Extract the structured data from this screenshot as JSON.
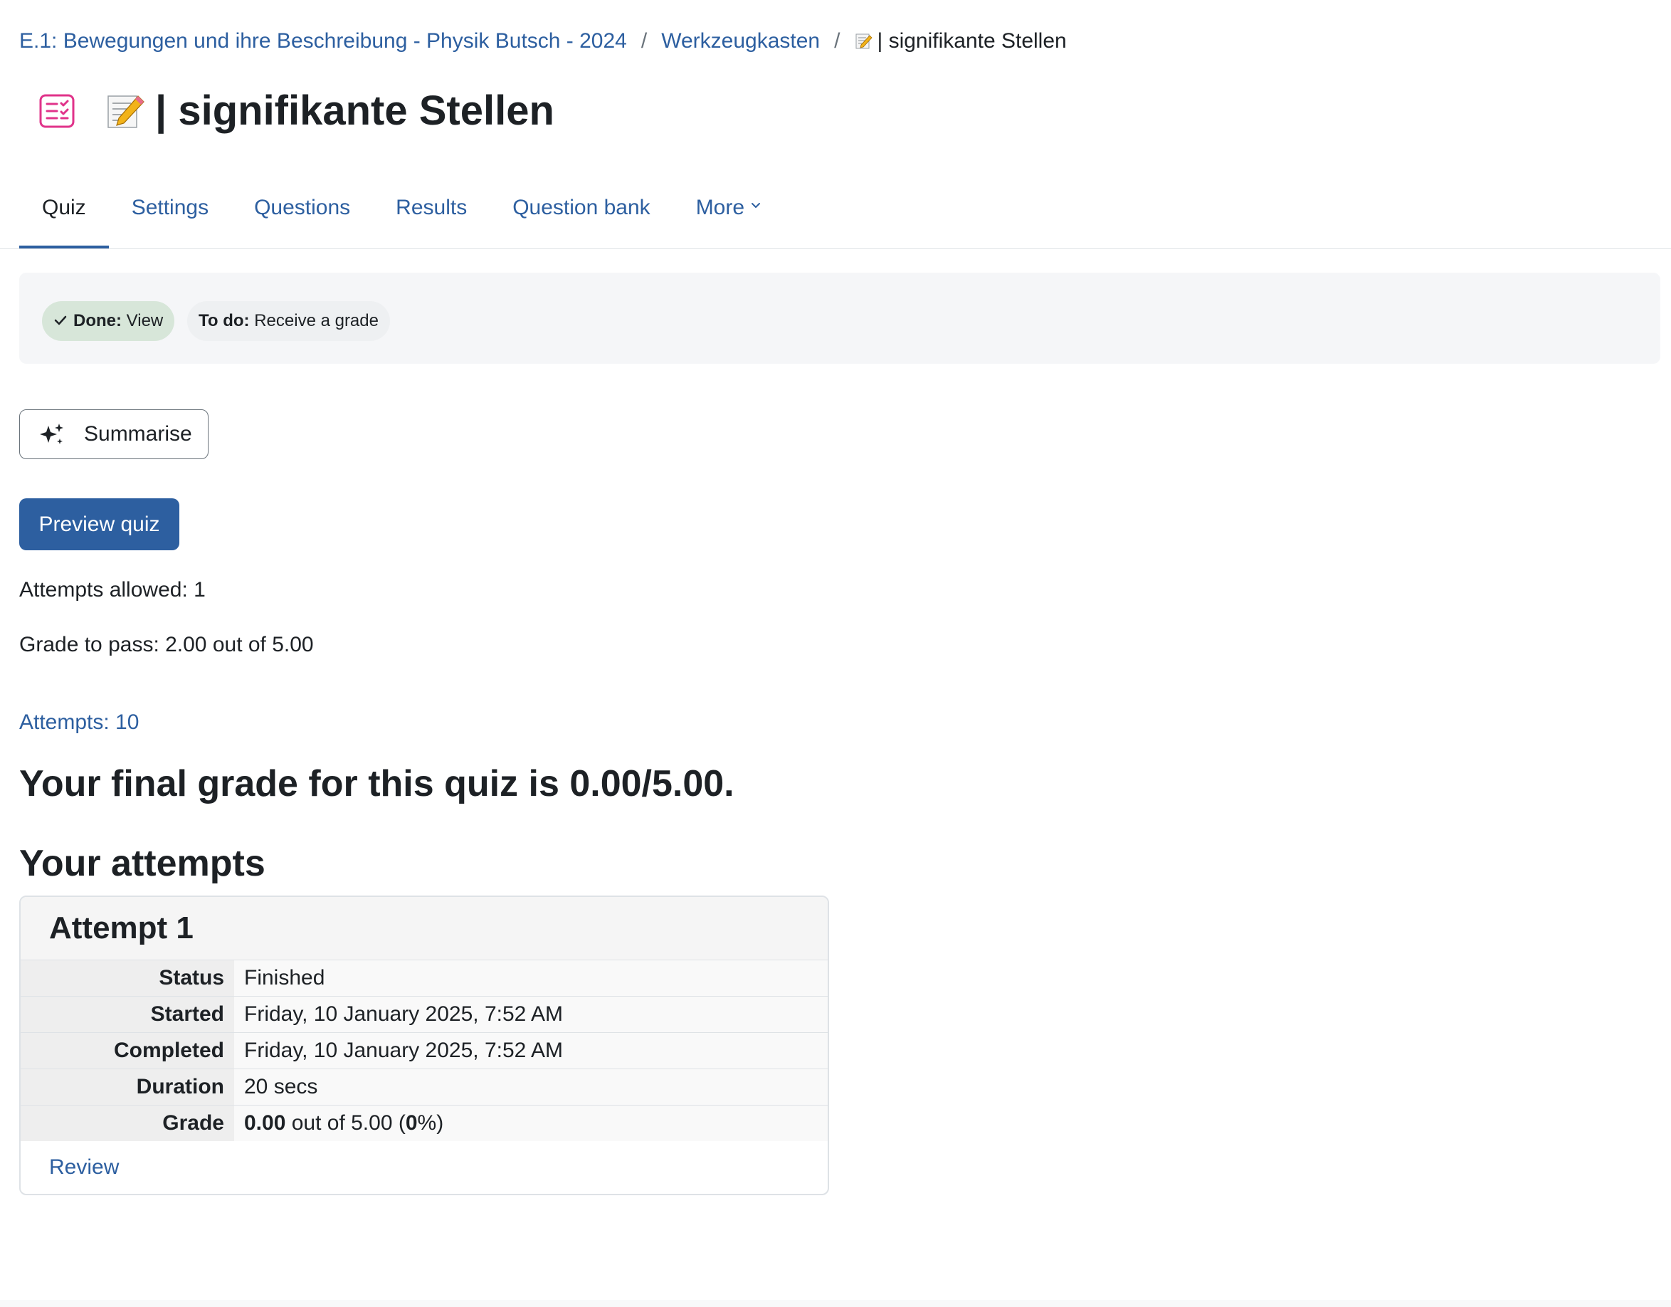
{
  "breadcrumb": {
    "course": "E.1: Bewegungen und ihre Beschreibung - Physik Butsch - 2024",
    "sep1": "/",
    "section": "Werkzeugkasten",
    "sep2": "/",
    "current": "| signifikante Stellen"
  },
  "header": {
    "title": "| signifikante Stellen",
    "icon": "quiz-icon",
    "emoji": "memo-pencil-icon"
  },
  "tabs": [
    {
      "label": "Quiz",
      "active": true
    },
    {
      "label": "Settings"
    },
    {
      "label": "Questions"
    },
    {
      "label": "Results"
    },
    {
      "label": "Question bank"
    },
    {
      "label": "More"
    }
  ],
  "completion": {
    "done_label": "Done:",
    "done_value": "View",
    "todo_label": "To do:",
    "todo_value": "Receive a grade"
  },
  "summarise_label": "Summarise",
  "preview_label": "Preview quiz",
  "attempts_allowed": "Attempts allowed: 1",
  "grade_to_pass": "Grade to pass: 2.00 out of 5.00",
  "attempts_link": "Attempts: 10",
  "final_grade": "Your final grade for this quiz is 0.00/5.00.",
  "your_attempts": "Your attempts",
  "attempt": {
    "title": "Attempt 1",
    "rows": [
      {
        "label": "Status",
        "value": "Finished"
      },
      {
        "label": "Started",
        "value": "Friday, 10 January 2025, 7:52 AM"
      },
      {
        "label": "Completed",
        "value": "Friday, 10 January 2025, 7:52 AM"
      },
      {
        "label": "Duration",
        "value": "20 secs"
      }
    ],
    "grade_label": "Grade",
    "grade_score": "0.00",
    "grade_mid": " out of 5.00 (",
    "grade_percent": "0",
    "grade_end": "%)",
    "review_label": "Review"
  },
  "colors": {
    "link": "#2d5fa0",
    "quiz_icon": "#e0338a",
    "done_badge": "#d7e6d9"
  }
}
